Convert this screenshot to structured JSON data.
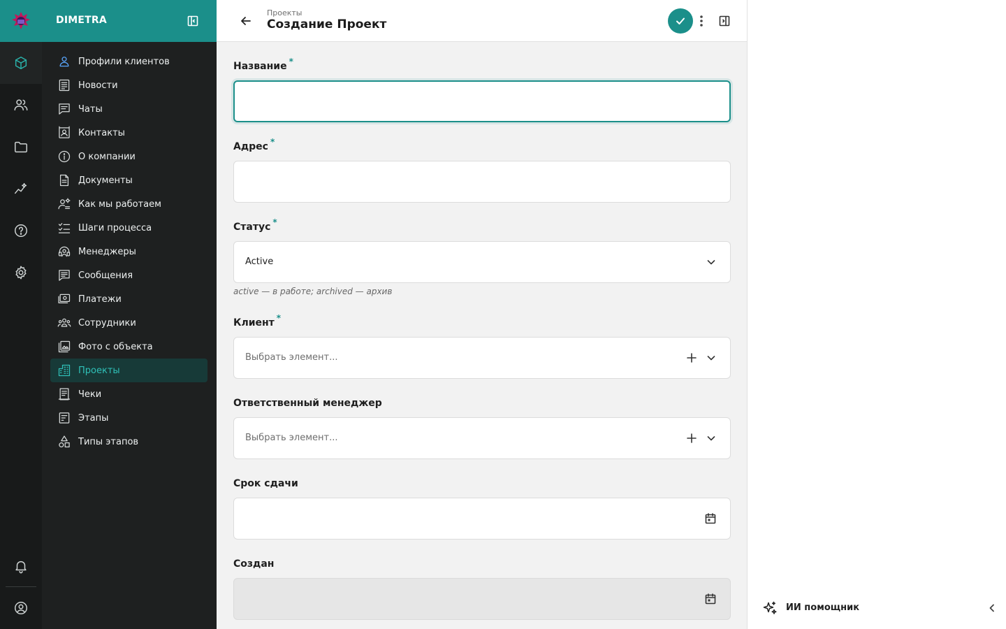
{
  "brand": {
    "name": "DIMETRA",
    "accent": "#1b8f8a"
  },
  "rail": {
    "items": [
      {
        "name": "cube-icon",
        "active": true
      },
      {
        "name": "users-icon",
        "active": false
      },
      {
        "name": "folder-icon",
        "active": false
      },
      {
        "name": "analytics-icon",
        "active": false
      },
      {
        "name": "help-icon",
        "active": false
      },
      {
        "name": "settings-icon",
        "active": false
      }
    ],
    "bottom": [
      "bell-icon",
      "user-circle-icon"
    ]
  },
  "nav": {
    "items": [
      {
        "label": "Профили клиентов",
        "icon": "person-icon"
      },
      {
        "label": "Новости",
        "icon": "news-icon"
      },
      {
        "label": "Чаты",
        "icon": "chat-icon"
      },
      {
        "label": "Контакты",
        "icon": "contact-card-icon"
      },
      {
        "label": "О компании",
        "icon": "info-icon"
      },
      {
        "label": "Документы",
        "icon": "document-icon"
      },
      {
        "label": "Как мы работаем",
        "icon": "person-gear-icon"
      },
      {
        "label": "Шаги процесса",
        "icon": "checklist-icon"
      },
      {
        "label": "Менеджеры",
        "icon": "headset-icon"
      },
      {
        "label": "Сообщения",
        "icon": "message-icon"
      },
      {
        "label": "Платежи",
        "icon": "payments-icon"
      },
      {
        "label": "Сотрудники",
        "icon": "team-icon"
      },
      {
        "label": "Фото с объекта",
        "icon": "photo-library-icon"
      },
      {
        "label": "Проекты",
        "icon": "building-icon",
        "active": true
      },
      {
        "label": "Чеки",
        "icon": "receipt-icon"
      },
      {
        "label": "Этапы",
        "icon": "stages-icon"
      },
      {
        "label": "Типы этапов",
        "icon": "shapes-icon"
      }
    ]
  },
  "header": {
    "breadcrumb": "Проекты",
    "title": "Создание Проект"
  },
  "form": {
    "name": {
      "label": "Название",
      "required": "*",
      "value": ""
    },
    "address": {
      "label": "Адрес",
      "required": "*",
      "value": ""
    },
    "status": {
      "label": "Статус",
      "required": "*",
      "value": "Active",
      "hint": "active — в работе; archived — архив"
    },
    "client": {
      "label": "Клиент",
      "required": "*",
      "placeholder": "Выбрать элемент..."
    },
    "manager": {
      "label": "Ответственный менеджер",
      "placeholder": "Выбрать элемент..."
    },
    "deadline": {
      "label": "Срок сдачи",
      "value": ""
    },
    "created": {
      "label": "Создан",
      "value": ""
    }
  },
  "assistant": {
    "label": "ИИ помощник"
  }
}
